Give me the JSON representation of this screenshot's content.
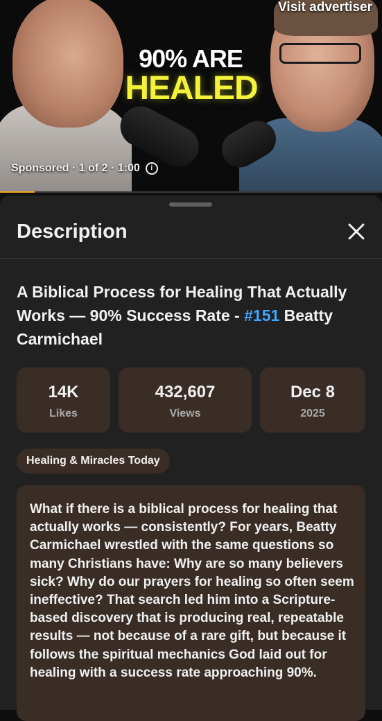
{
  "ad": {
    "headline_top": "90% ARE",
    "headline_bottom": "HEALED",
    "visit_label": "Visit advertiser",
    "sponsored_text": "Sponsored · 1 of 2 · 1:00",
    "info_icon": "info-icon",
    "progress_fraction": 0.09,
    "headline_color": "#f3f33a",
    "progress_color": "#f2a51a"
  },
  "panel": {
    "title": "Description",
    "close_icon": "close-icon"
  },
  "video": {
    "title_main": "A Biblical Process for Healing That Actually Works — 90% Success Rate -",
    "title_hashtag": "#151",
    "title_tail": " Beatty Carmichael",
    "hashtag_color": "#3ea6ff"
  },
  "stats": [
    {
      "value": "14K",
      "label": "Likes"
    },
    {
      "value": "432,607",
      "label": "Views"
    },
    {
      "value": "Dec 8",
      "label": "2025"
    }
  ],
  "channel_chip": "Healing & Miracles Today",
  "description": "What if there is a biblical process for healing that actually works — consistently? For years, Beatty Carmichael wrestled with the same questions so many Christians have: Why are so many believers sick? Why do our prayers for healing so often seem ineffective? That search led him into a Scripture-based discovery that is producing real, repeatable results — not because of a rare gift, but because it follows the spiritual mechanics God laid out for healing with a success rate approaching 90%."
}
